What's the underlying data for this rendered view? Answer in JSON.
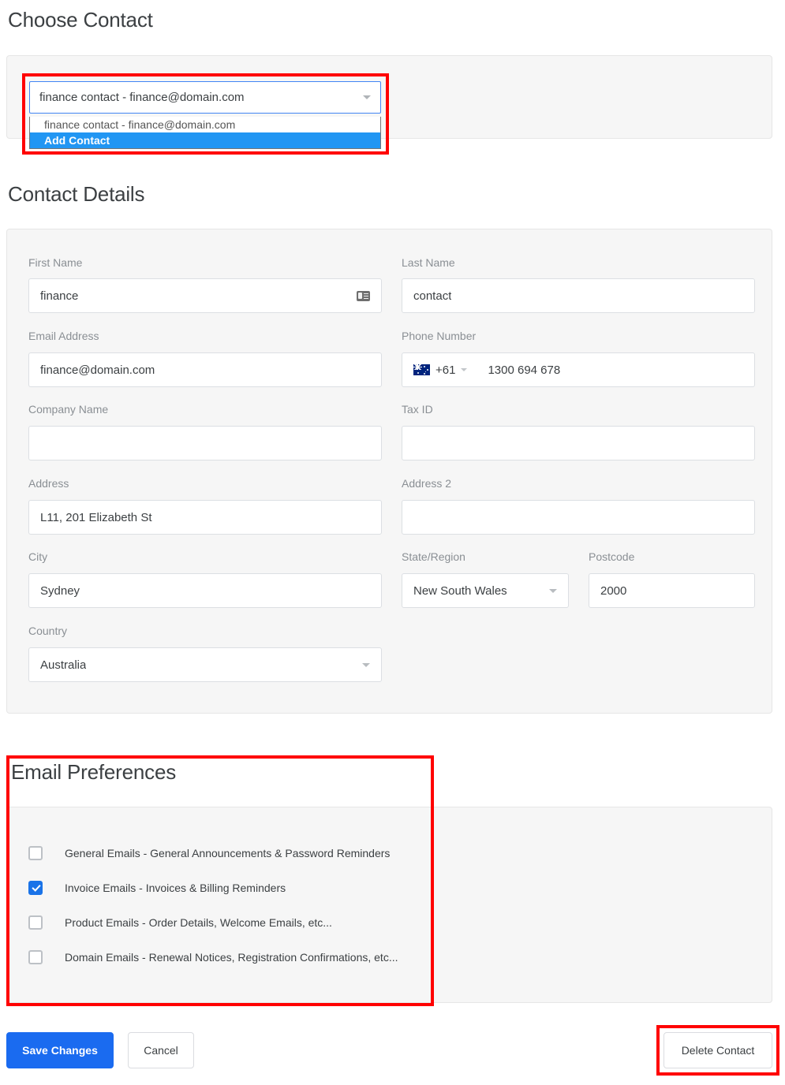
{
  "choose_contact": {
    "heading": "Choose Contact",
    "selected_value": "finance contact - finance@domain.com",
    "options": [
      "finance contact - finance@domain.com",
      "Add Contact"
    ],
    "highlighted_option": "Add Contact"
  },
  "contact_details": {
    "heading": "Contact Details",
    "fields": {
      "first_name": {
        "label": "First Name",
        "value": "finance"
      },
      "last_name": {
        "label": "Last Name",
        "value": "contact"
      },
      "email_address": {
        "label": "Email Address",
        "value": "finance@domain.com"
      },
      "phone_number": {
        "label": "Phone Number",
        "country_code": "+61",
        "flag": "au-flag-icon",
        "value": "1300 694 678"
      },
      "company_name": {
        "label": "Company Name",
        "value": ""
      },
      "tax_id": {
        "label": "Tax ID",
        "value": ""
      },
      "address": {
        "label": "Address",
        "value": "L11, 201 Elizabeth St"
      },
      "address2": {
        "label": "Address 2",
        "value": ""
      },
      "city": {
        "label": "City",
        "value": "Sydney"
      },
      "state_region": {
        "label": "State/Region",
        "value": "New South Wales"
      },
      "postcode": {
        "label": "Postcode",
        "value": "2000"
      },
      "country": {
        "label": "Country",
        "value": "Australia"
      }
    }
  },
  "email_preferences": {
    "heading": "Email Preferences",
    "items": [
      {
        "label": "General Emails - General Announcements & Password Reminders",
        "checked": false
      },
      {
        "label": "Invoice Emails - Invoices & Billing Reminders",
        "checked": true
      },
      {
        "label": "Product Emails - Order Details, Welcome Emails, etc...",
        "checked": false
      },
      {
        "label": "Domain Emails - Renewal Notices, Registration Confirmations, etc...",
        "checked": false
      }
    ]
  },
  "actions": {
    "save": "Save Changes",
    "cancel": "Cancel",
    "delete": "Delete Contact"
  },
  "colors": {
    "accent_blue": "#1a6bf0",
    "checkbox_blue": "#1a73e8",
    "highlight_blue": "#2196f3",
    "annotation_red": "#ff0000",
    "panel_bg": "#f6f6f6",
    "label_gray": "#8a8f94"
  }
}
